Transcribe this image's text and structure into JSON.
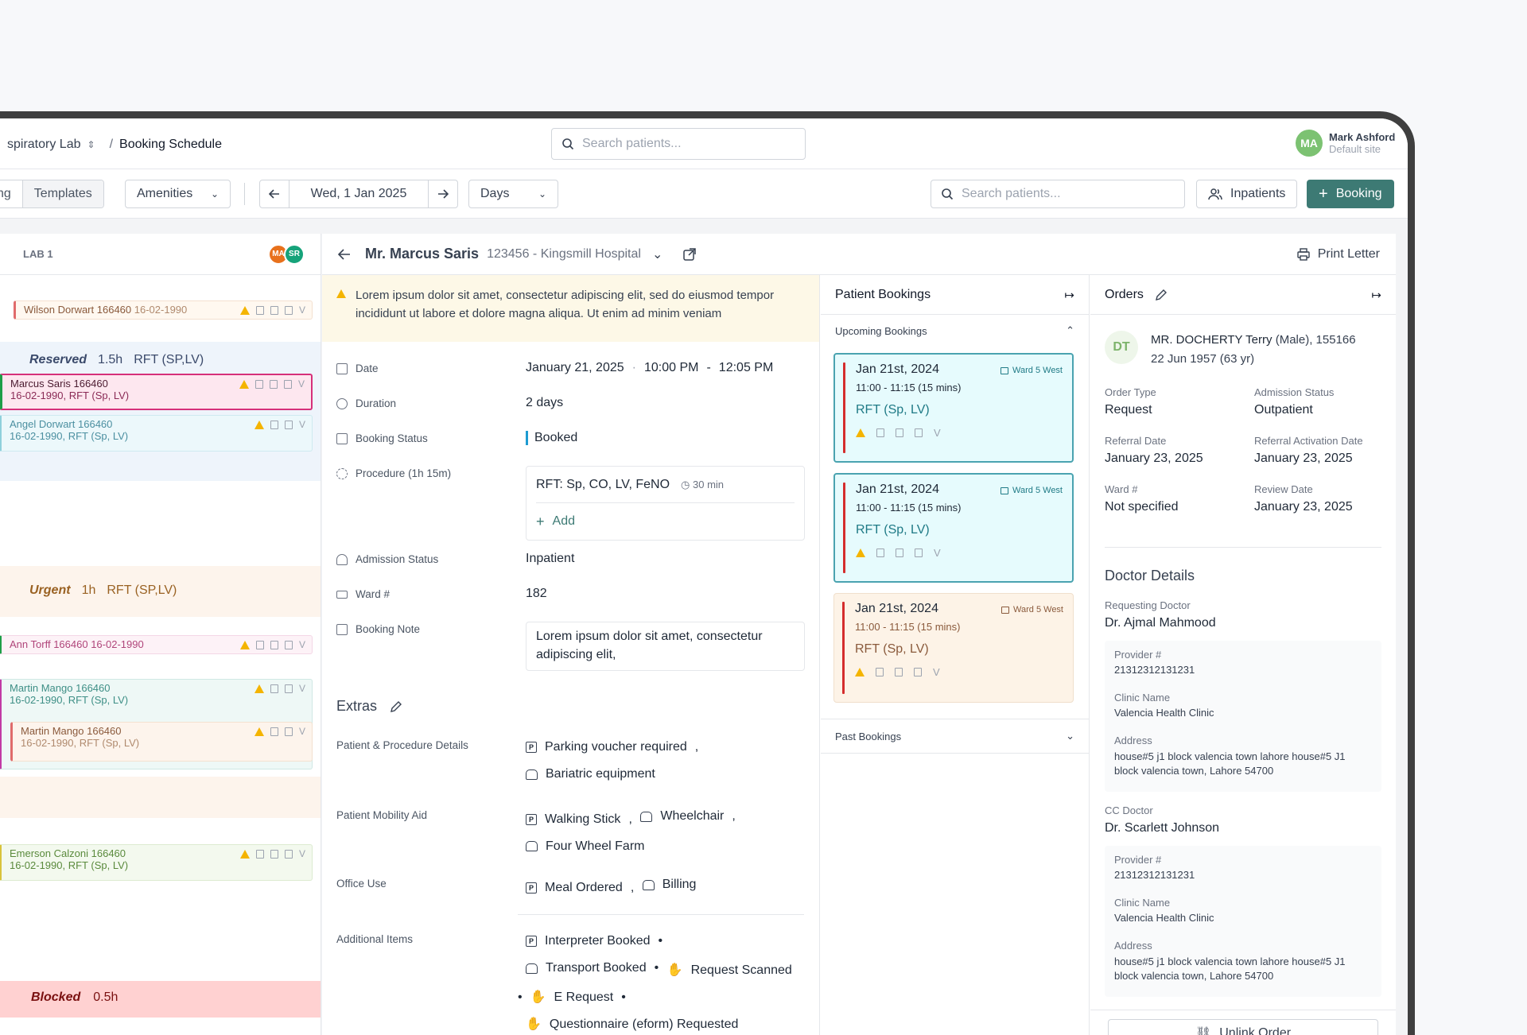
{
  "header": {
    "breadcrumb_parent": "spiratory Lab",
    "breadcrumb_sep": "/",
    "breadcrumb_current": "Booking Schedule",
    "search_placeholder": "Search patients...",
    "user_initials": "MA",
    "user_name": "Mark Ashford",
    "user_site": "Default site"
  },
  "toolbar": {
    "seg_prev": "ng",
    "seg_templates": "Templates",
    "amenities": "Amenities",
    "date": "Wed, 1 Jan 2025",
    "view": "Days",
    "search_placeholder": "Search patients...",
    "inpatients": "Inpatients",
    "booking": "Booking"
  },
  "schedule": {
    "lab": "LAB 1",
    "avatars": [
      {
        "i": "MA",
        "c": "#e8711c"
      },
      {
        "i": "SR",
        "c": "#16a37a"
      }
    ],
    "slots": [
      {
        "name": "Wilson Dorwart",
        "id": "166460",
        "dob": "16-02-1990",
        "line2": ""
      },
      {
        "name": "Marcus Saris",
        "id": "166460",
        "dob": "",
        "line2": "16-02-1990, RFT (Sp, LV)"
      },
      {
        "name": "Angel Dorwart",
        "id": "166460",
        "dob": "",
        "line2": "16-02-1990, RFT (Sp, LV)"
      },
      {
        "name": "Ann Torff",
        "id": "166460",
        "dob": "16-02-1990",
        "line2": ""
      },
      {
        "name": "Martin Mango",
        "id": "166460",
        "dob": "",
        "line2": "16-02-1990, RFT (Sp, LV)"
      },
      {
        "name": "Martin Mango",
        "id": "166460",
        "dob": "",
        "line2": "16-02-1990, RFT (Sp, LV)"
      },
      {
        "name": "Emerson Calzoni",
        "id": "166460",
        "dob": "",
        "line2": "16-02-1990, RFT (Sp, LV)"
      }
    ],
    "groups": {
      "reserved": {
        "label": "Reserved",
        "dur": "1.5h",
        "proc": "RFT (SP,LV)"
      },
      "urgent": {
        "label": "Urgent",
        "dur": "1h",
        "proc": "RFT (SP,LV)"
      },
      "blocked": {
        "label": "Blocked",
        "dur": "0.5h"
      }
    },
    "v": "V"
  },
  "patient": {
    "name": "Mr. Marcus Saris",
    "sub": "123456 - Kingsmill Hospital",
    "print": "Print Letter",
    "warning": "Lorem ipsum dolor sit amet, consectetur adipiscing elit, sed do eiusmod tempor incididunt ut labore et dolore magna aliqua. Ut enim ad minim veniam",
    "date_label": "Date",
    "date": "January 21, 2025",
    "date_dot": "·",
    "time_from": "10:00 PM",
    "time_dash": "-",
    "time_to": "12:05 PM",
    "duration_label": "Duration",
    "duration": "2 days",
    "status_label": "Booking Status",
    "status": "Booked",
    "procedure_label": "Procedure",
    "procedure_dur": "(1h 15m)",
    "procedure": "RFT: Sp, CO, LV, FeNO",
    "procedure_time": "30 min",
    "add": "Add",
    "admission_label": "Admission Status",
    "admission": "Inpatient",
    "ward_label": "Ward #",
    "ward": "182",
    "note_label": "Booking Note",
    "note": "Lorem ipsum dolor sit amet, consectetur adipiscing elit,",
    "extras": "Extras",
    "ppd_label": "Patient & Procedure Details",
    "ppd": [
      "Parking voucher required",
      "Bariatric equipment"
    ],
    "pma_label": "Patient Mobility Aid",
    "pma": [
      "Walking Stick",
      "Wheelchair",
      "Four Wheel Farm"
    ],
    "office_label": "Office Use",
    "office": [
      "Meal Ordered",
      "Billing"
    ],
    "addl_label": "Additional Items",
    "addl": [
      "Interpreter Booked",
      "Transport Booked",
      "Request Scanned",
      "E Request",
      "Questionnaire (eform) Requested"
    ],
    "comma": ",",
    "bullet": "•"
  },
  "bookings": {
    "title": "Patient Bookings",
    "upcoming": "Upcoming Bookings",
    "past": "Past Bookings",
    "items": [
      {
        "date": "Jan 21st, 2024",
        "ward": "Ward 5 West",
        "time": "11:00 - 11:15 (15 mins)",
        "proc": "RFT (Sp, LV)"
      },
      {
        "date": "Jan 21st, 2024",
        "ward": "Ward 5 West",
        "time": "11:00 - 11:15 (15 mins)",
        "proc": "RFT (Sp, LV)"
      },
      {
        "date": "Jan 21st, 2024",
        "ward": "Ward 5 West",
        "time": "11:00 - 11:15 (15 mins)",
        "proc": "RFT (Sp, LV)"
      }
    ]
  },
  "orders": {
    "title": "Orders",
    "initials": "DT",
    "patient": "MR. DOCHERTY Terry",
    "patient_meta": "(Male),  155166",
    "dob": "22 Jun 1957 (63 yr)",
    "order_type_label": "Order Type",
    "order_type": "Request",
    "adm_label": "Admission Status",
    "adm": "Outpatient",
    "ref_label": "Referral Date",
    "ref": "January 23, 2025",
    "refact_label": "Referral Activation Date",
    "refact": "January 23, 2025",
    "ward_label": "Ward #",
    "ward": "Not specified",
    "review_label": "Review Date",
    "review": "January 23, 2025",
    "doctor_title": "Doctor Details",
    "req_label": "Requesting Doctor",
    "req": "Dr. Ajmal Mahmood",
    "prov_label": "Provider #",
    "prov": "21312312131231",
    "clinic_label": "Clinic Name",
    "clinic": "Valencia Health Clinic",
    "addr_label": "Address",
    "addr": "house#5 j1 block valencia town lahore house#5 J1 block valencia town, Lahore 54700",
    "cc_label": "CC Doctor",
    "cc": "Dr. Scarlett Johnson",
    "unlink": "Unlink Order"
  },
  "colors": {
    "accent": "#3d7a74",
    "booked": "#1d9bd1",
    "warning": "#f4b400",
    "upcoming_card": "#e6fbfd",
    "past_card": "#fdf3e7"
  }
}
